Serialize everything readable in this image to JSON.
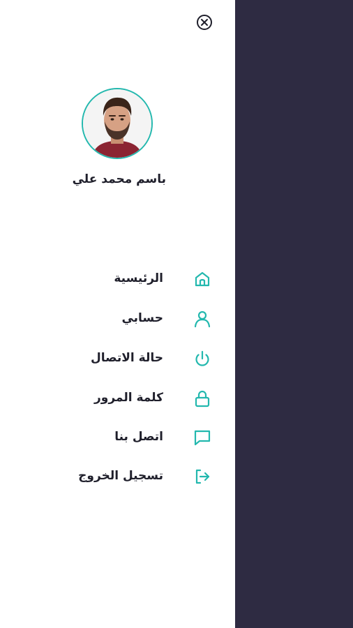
{
  "user": {
    "name": "باسم محمد علي"
  },
  "colors": {
    "accent": "#23b8ae",
    "overlay": "#2e2b42",
    "text": "#1f1f2b"
  },
  "menu": {
    "items": [
      {
        "label": "الرئيسية",
        "icon": "home-icon"
      },
      {
        "label": "حسابي",
        "icon": "user-icon"
      },
      {
        "label": "حالة الاتصال",
        "icon": "power-icon"
      },
      {
        "label": "كلمة المرور",
        "icon": "lock-icon"
      },
      {
        "label": "اتصل بنا",
        "icon": "message-icon"
      },
      {
        "label": "تسجيل الخروج",
        "icon": "logout-icon"
      }
    ]
  }
}
